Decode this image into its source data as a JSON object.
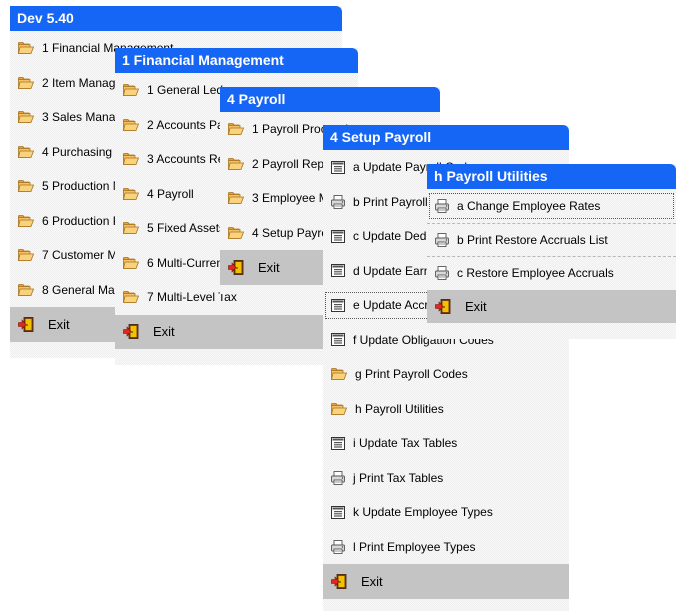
{
  "menus": [
    {
      "title": "Dev 5.40",
      "items": [
        {
          "label": "1 Financial Management",
          "icon": "folder-icon"
        },
        {
          "label": "2 Item Management",
          "icon": "folder-icon"
        },
        {
          "label": "3 Sales Management",
          "icon": "folder-icon"
        },
        {
          "label": "4 Purchasing Management",
          "icon": "folder-icon"
        },
        {
          "label": "5 Production Management",
          "icon": "folder-icon"
        },
        {
          "label": "6 Production Planning",
          "icon": "folder-icon"
        },
        {
          "label": "7 Customer Management",
          "icon": "folder-icon"
        },
        {
          "label": "8 General Management",
          "icon": "folder-icon"
        }
      ],
      "exit_label": "Exit"
    },
    {
      "title": "1 Financial Management",
      "items": [
        {
          "label": "1 General Ledger",
          "icon": "folder-icon"
        },
        {
          "label": "2 Accounts Payable",
          "icon": "folder-icon"
        },
        {
          "label": "3 Accounts Receivable",
          "icon": "folder-icon"
        },
        {
          "label": "4 Payroll",
          "icon": "folder-icon"
        },
        {
          "label": "5 Fixed Assets",
          "icon": "folder-icon"
        },
        {
          "label": "6 Multi-Currency",
          "icon": "folder-icon"
        },
        {
          "label": "7 Multi-Level Tax",
          "icon": "folder-icon"
        }
      ],
      "exit_label": "Exit"
    },
    {
      "title": "4 Payroll",
      "items": [
        {
          "label": "1 Payroll Processing",
          "icon": "folder-icon"
        },
        {
          "label": "2 Payroll Reports",
          "icon": "folder-icon"
        },
        {
          "label": "3 Employee Management",
          "icon": "folder-icon"
        },
        {
          "label": "4 Setup Payroll",
          "icon": "folder-icon"
        }
      ],
      "exit_label": "Exit"
    },
    {
      "title": "4 Setup Payroll",
      "items": [
        {
          "label": "a Update Payroll Codes",
          "icon": "form-icon"
        },
        {
          "label": "b Print Payroll Codes",
          "icon": "print-icon"
        },
        {
          "label": "c Update Deduction Codes",
          "icon": "form-icon"
        },
        {
          "label": "d Update Earning Codes",
          "icon": "form-icon"
        },
        {
          "label": "e Update Accrual Codes",
          "icon": "form-icon"
        },
        {
          "label": "f Update Obligation Codes",
          "icon": "form-icon"
        },
        {
          "label": "g Print Payroll Codes",
          "icon": "folder-icon"
        },
        {
          "label": "h Payroll Utilities",
          "icon": "folder-icon"
        },
        {
          "label": "i Update Tax Tables",
          "icon": "form-icon"
        },
        {
          "label": "j Print Tax Tables",
          "icon": "print-icon"
        },
        {
          "label": "k Update Employee Types",
          "icon": "form-icon"
        },
        {
          "label": "l Print Employee Types",
          "icon": "print-icon"
        }
      ],
      "exit_label": "Exit"
    },
    {
      "title": "h  Payroll Utilities",
      "items": [
        {
          "label": "a Change Employee Rates",
          "icon": "print-icon"
        },
        {
          "label": "b Print Restore Accruals List",
          "icon": "print-icon"
        },
        {
          "label": "c Restore Employee Accruals",
          "icon": "print-icon"
        }
      ],
      "exit_label": "Exit"
    }
  ]
}
